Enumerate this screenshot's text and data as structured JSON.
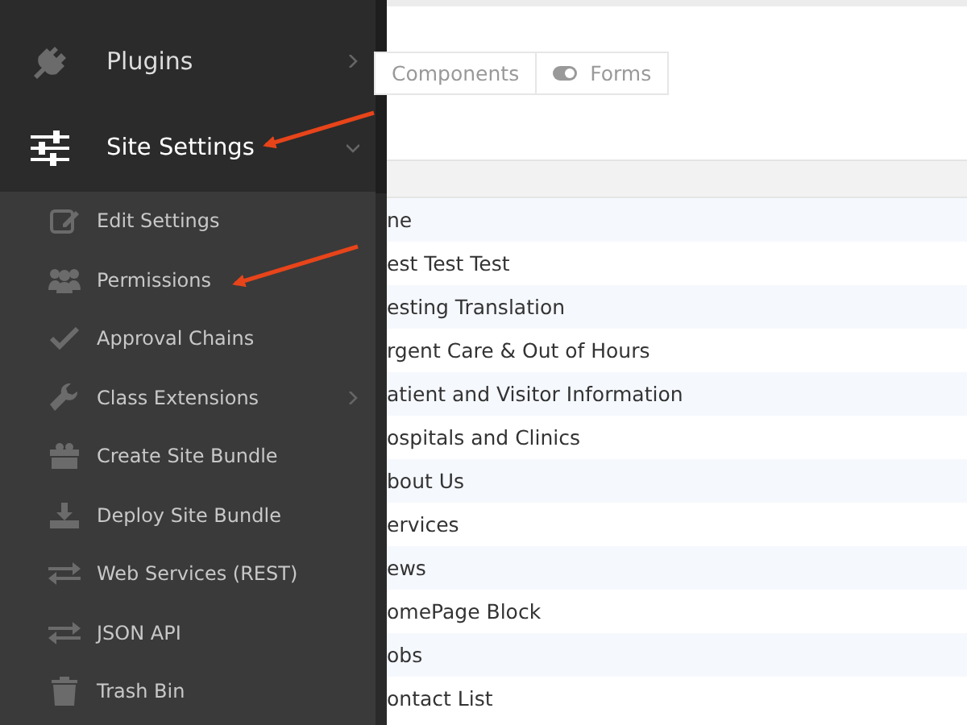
{
  "sidebar": {
    "items": [
      {
        "label": "Plugins",
        "expanded": false,
        "has_submenu": true
      },
      {
        "label": "Site Settings",
        "expanded": true,
        "has_submenu": true,
        "children": [
          {
            "label": "Edit Settings",
            "has_submenu": false
          },
          {
            "label": "Permissions",
            "has_submenu": false
          },
          {
            "label": "Approval Chains",
            "has_submenu": false
          },
          {
            "label": "Class Extensions",
            "has_submenu": true
          },
          {
            "label": "Create Site Bundle",
            "has_submenu": false
          },
          {
            "label": "Deploy Site Bundle",
            "has_submenu": false
          },
          {
            "label": "Web Services (REST)",
            "has_submenu": false
          },
          {
            "label": "JSON API",
            "has_submenu": false
          },
          {
            "label": "Trash Bin",
            "has_submenu": false
          }
        ]
      }
    ]
  },
  "tabs": [
    {
      "label": "Components"
    },
    {
      "label": "Forms"
    }
  ],
  "table": {
    "rows": [
      "ne",
      "est Test Test",
      "esting Translation",
      "rgent Care & Out of Hours",
      "atient and Visitor Information",
      "ospitals and Clinics",
      "bout Us",
      "ervices",
      "ews",
      "omePage Block",
      "obs",
      "ontact List"
    ]
  }
}
